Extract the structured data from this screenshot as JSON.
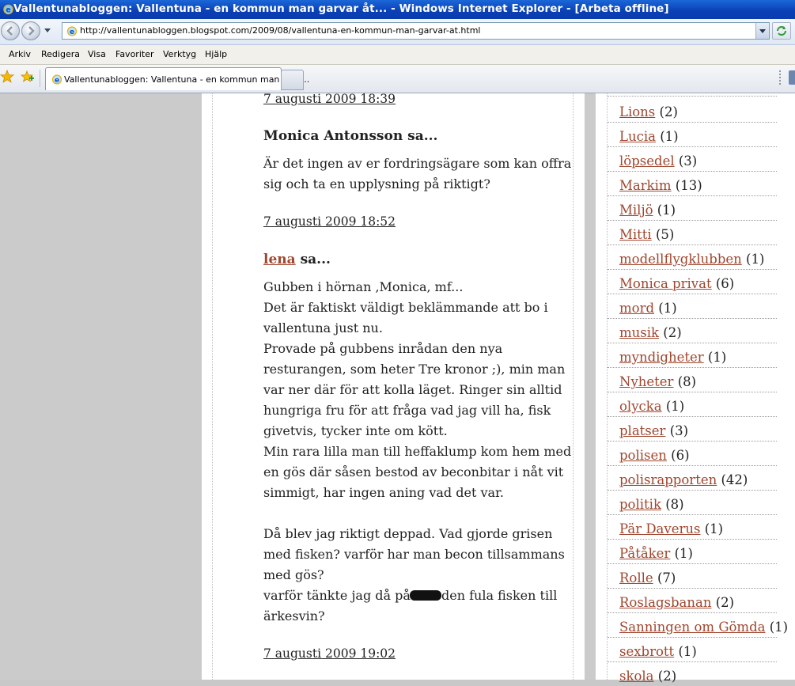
{
  "window": {
    "title": "Vallentunabloggen: Vallentuna - en kommun man garvar åt... - Windows Internet Explorer - [Arbeta offline]",
    "url": "http://vallentunabloggen.blogspot.com/2009/08/vallentuna-en-kommun-man-garvar-at.html"
  },
  "menu": [
    "Arkiv",
    "Redigera",
    "Visa",
    "Favoriter",
    "Verktyg",
    "Hjälp"
  ],
  "tab": {
    "label": "Vallentunabloggen: Vallentuna - en kommun man garv..."
  },
  "comments": [
    {
      "timestamp": "7 augusti 2009 18:39"
    },
    {
      "author": "Monica Antonsson",
      "suffix": " sa...",
      "lines": [
        "Är det ingen av er fordringsägare som kan offra",
        "sig och ta en upplysning på riktigt?"
      ],
      "timestamp": "7 augusti 2009 18:52"
    },
    {
      "author": "lena",
      "suffix": " sa...",
      "lines": [
        "Gubben i hörnan ,Monica, mf...",
        "Det är faktiskt väldigt beklämmande att bo i",
        "vallentuna just nu.",
        "Provade på gubbens inrådan den nya",
        "resturangen, som heter Tre kronor ;), min man",
        "var ner där för att kolla läget. Ringer sin alltid",
        "hungriga fru för att fråga vad jag vill ha, fisk",
        "givetvis, tycker inte om kött.",
        "Min rara lilla man till heffaklump kom hem med",
        "en gös där såsen bestod av beconbitar i nåt vit",
        "simmigt, har ingen aning vad det var.",
        "",
        "Då blev jag riktigt deppad. Vad gjorde grisen",
        "med fisken? varför har man becon tillsammans",
        "med gös?"
      ],
      "redacted_line": {
        "before": "varför tänkte jag då på ",
        "after": "den fula fisken till"
      },
      "last_line": "ärkesvin?",
      "timestamp": "7 augusti 2009 19:02"
    }
  ],
  "labels": [
    {
      "name": "Lions",
      "count": "(2)"
    },
    {
      "name": "Lucia",
      "count": "(1)"
    },
    {
      "name": "löpsedel",
      "count": "(3)"
    },
    {
      "name": "Markim",
      "count": "(13)"
    },
    {
      "name": "Miljö",
      "count": "(1)"
    },
    {
      "name": "Mitti",
      "count": "(5)"
    },
    {
      "name": "modellflygklubben",
      "count": "(1)"
    },
    {
      "name": "Monica privat",
      "count": "(6)"
    },
    {
      "name": "mord",
      "count": "(1)"
    },
    {
      "name": "musik",
      "count": "(2)"
    },
    {
      "name": "myndigheter",
      "count": "(1)"
    },
    {
      "name": "Nyheter",
      "count": "(8)"
    },
    {
      "name": "olycka",
      "count": "(1)"
    },
    {
      "name": "platser",
      "count": "(3)"
    },
    {
      "name": "polisen",
      "count": "(6)"
    },
    {
      "name": "polisrapporten",
      "count": "(42)"
    },
    {
      "name": "politik",
      "count": "(8)"
    },
    {
      "name": "Pär Daverus",
      "count": "(1)"
    },
    {
      "name": "Påtåker",
      "count": "(1)"
    },
    {
      "name": "Rolle",
      "count": "(7)"
    },
    {
      "name": "Roslagsbanan",
      "count": "(2)"
    },
    {
      "name": "Sanningen om Gömda",
      "count": "(1)"
    },
    {
      "name": "sexbrott",
      "count": "(1)"
    },
    {
      "name": "skola",
      "count": "(2)"
    }
  ]
}
